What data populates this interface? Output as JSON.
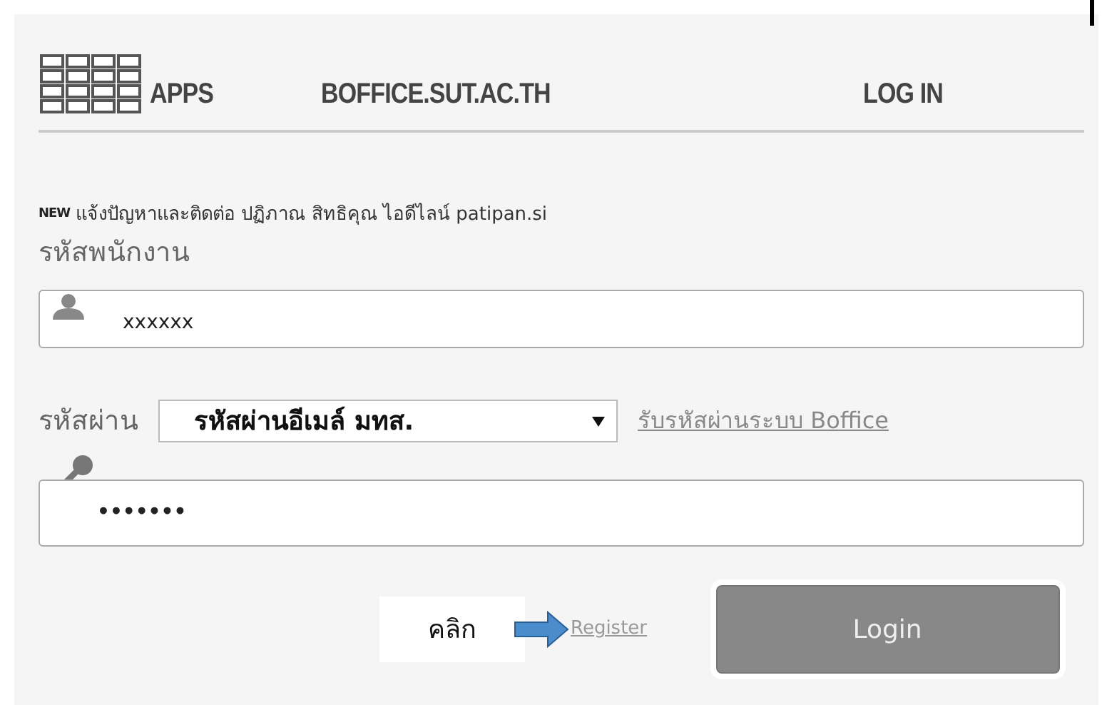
{
  "header": {
    "apps_label": "APPS",
    "site_title": "BOFFICE.SUT.AC.TH",
    "login_link": "LOG IN"
  },
  "notice": {
    "badge": "NEW",
    "text": "แจ้งปัญหาและติดต่อ ปฏิภาณ สิทธิคุณ ไอดีไลน์ patipan.si"
  },
  "username": {
    "label": "รหัสพนักงาน",
    "value": "xxxxxx"
  },
  "password": {
    "label": "รหัสผ่าน",
    "type_select": "รหัสผ่านอีเมล์ มทส.",
    "link": "รับรหัสผ่านระบบ Boffice",
    "value": "•••••••"
  },
  "footer": {
    "callout": "คลิก",
    "register_link": "Register",
    "login_button": "Login"
  }
}
